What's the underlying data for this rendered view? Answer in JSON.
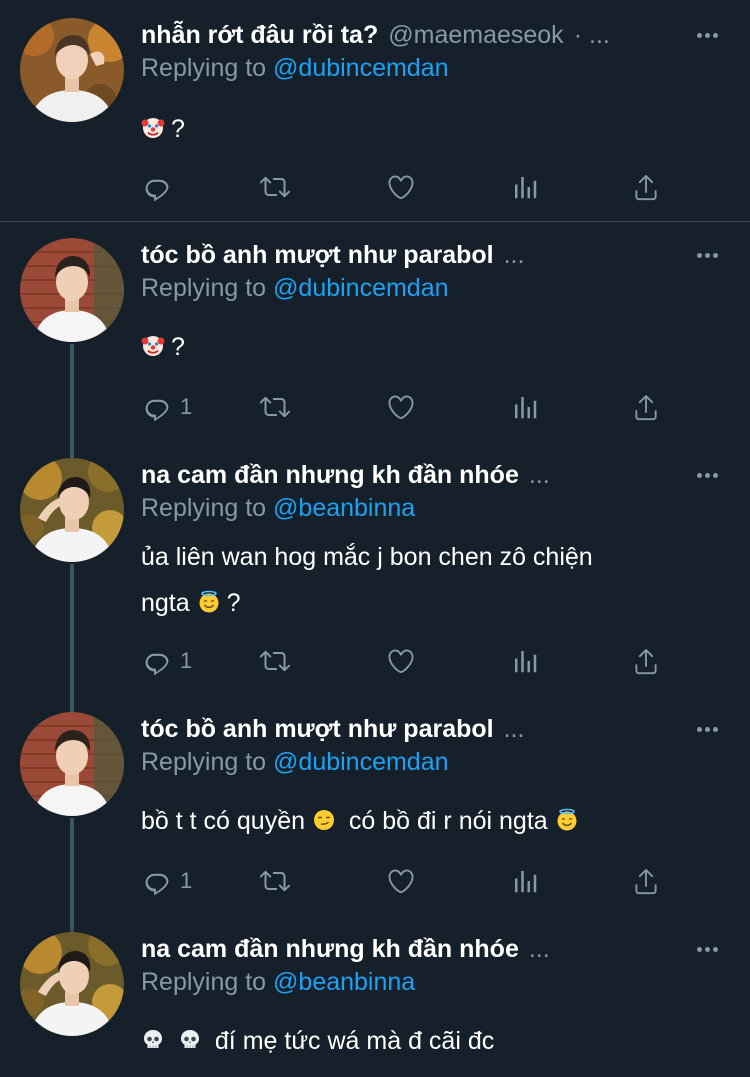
{
  "colors": {
    "background": "#15202b",
    "text": "#ffffff",
    "secondary": "#8899a6",
    "accent": "#1da1f2",
    "divider": "#38444d"
  },
  "tweets": [
    {
      "name": "nhẫn rớt đâu rồi ta?",
      "handle": "@maemaeseok",
      "ellipsis": "· ...",
      "replying_label": "Replying to",
      "mention": "@dubincemdan",
      "emojis": [
        "clown-face-emoji"
      ],
      "text": "?",
      "reply_count": ""
    },
    {
      "name": "tóc bồ anh mượt như parabol",
      "handle": "",
      "ellipsis": "...",
      "replying_label": "Replying to",
      "mention": "@dubincemdan",
      "emojis": [
        "clown-face-emoji"
      ],
      "text": "?",
      "reply_count": "1"
    },
    {
      "name": "na cam đần nhưng kh đần nhóe",
      "handle": "",
      "ellipsis": "...",
      "replying_label": "Replying to",
      "mention": "@beanbinna",
      "text_line1": "ủa liên wan hog mắc j bon chen zô chiện",
      "text_line2": "ngta",
      "emojis": [
        "halo-smile-emoji"
      ],
      "text_after": "?",
      "reply_count": "1"
    },
    {
      "name": "tóc bồ anh mượt như parabol",
      "handle": "",
      "ellipsis": "...",
      "replying_label": "Replying to",
      "mention": "@dubincemdan",
      "text_part1": "bồ t t có quyền",
      "text_part2": "có bồ đi r nói ngta",
      "emojis": [
        "smirk-emoji",
        "halo-smile-emoji"
      ],
      "reply_count": "1"
    },
    {
      "name": "na cam đần nhưng kh đần nhóe",
      "handle": "",
      "ellipsis": "...",
      "replying_label": "Replying to",
      "mention": "@beanbinna",
      "emojis": [
        "skull-emoji",
        "skull-emoji"
      ],
      "text": "đí mẹ tức wá mà đ cãi đc"
    }
  ]
}
